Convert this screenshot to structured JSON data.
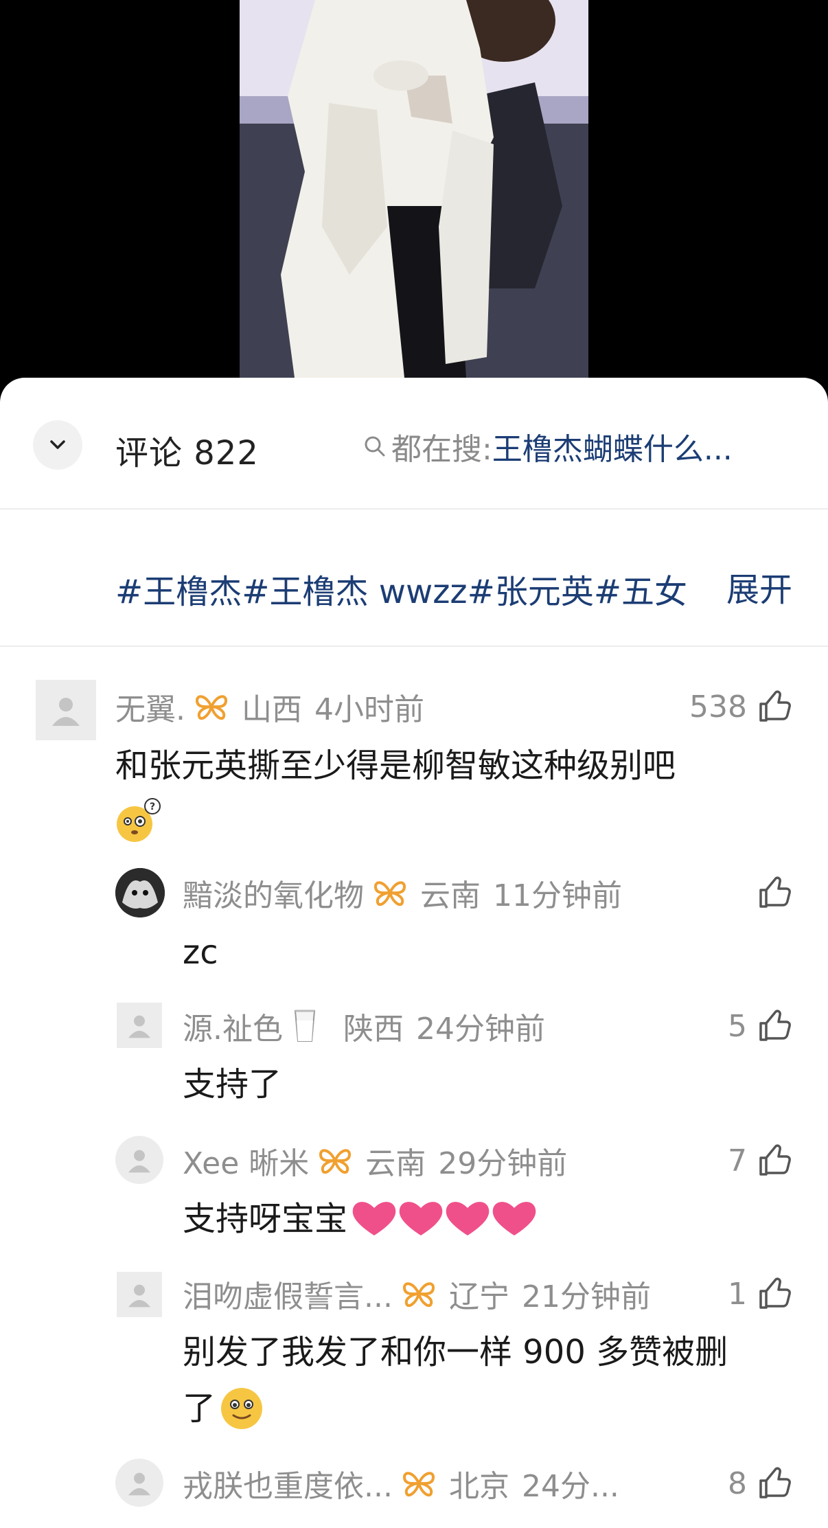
{
  "colors": {
    "accent": "#1c3d74",
    "muted": "#8e8e8e",
    "badge": "#f0a030",
    "heart": "#f0508a"
  },
  "header": {
    "comment_count": "评论 822",
    "search_prefix": "都在搜:",
    "search_keyword": "王橹杰蝴蝶什么..."
  },
  "tags": {
    "text": "#王橹杰#王橹杰 wwzz#张元英#五女",
    "expand": "展开"
  },
  "comments": [
    {
      "user": "无翼.",
      "location": "山西",
      "time": "4小时前",
      "likes": "538",
      "text_line1": "和张元英撕至少得是柳智敏这种级别吧",
      "emoji": "thinking-face"
    },
    {
      "user": "黯淡的氧化物",
      "location": "云南",
      "time": "11分钟前",
      "likes": "",
      "text": "zc"
    },
    {
      "user": "源.祉色",
      "location": "陕西",
      "time": "24分钟前",
      "likes": "5",
      "text": "支持了",
      "emoji": "milk-glass"
    },
    {
      "user": "Xee 晰米",
      "location": "云南",
      "time": "29分钟前",
      "likes": "7",
      "text": "支持呀宝宝"
    },
    {
      "user": "泪吻虚假誓言...",
      "location": "辽宁",
      "time": "21分钟前",
      "likes": "1",
      "text_line1": "别发了我发了和你一样 900 多赞被删",
      "text_line2": "了"
    },
    {
      "user": "戎朕也重度依...",
      "location": "北京",
      "time": "24分...",
      "likes": "8"
    }
  ]
}
